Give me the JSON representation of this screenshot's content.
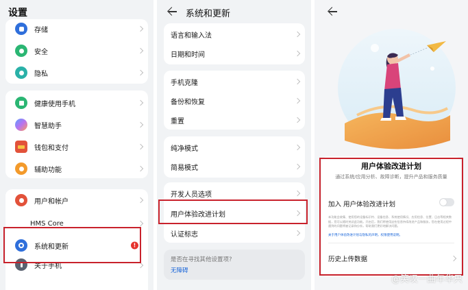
{
  "settings": {
    "title": "设置",
    "group1": [
      "存储",
      "安全",
      "隐私"
    ],
    "group2": [
      "健康使用手机",
      "智慧助手",
      "钱包和支付",
      "辅助功能"
    ],
    "group3": [
      "用户和帐户",
      "HMS Core",
      "系统和更新",
      "关于手机"
    ],
    "badge": "!"
  },
  "system": {
    "title": "系统和更新",
    "group1": [
      "语言和输入法",
      "日期和时间"
    ],
    "group2": [
      "手机克隆",
      "备份和恢复",
      "重置"
    ],
    "group3": [
      "纯净模式",
      "简易模式"
    ],
    "group4": [
      "开发人员选项",
      "用户体验改进计划",
      "认证标志"
    ],
    "hint_question": "是否在寻找其他设置项?",
    "hint_link": "无障碍"
  },
  "ux": {
    "title": "用户体验改进计划",
    "subtitle": "通过系统/应用分析、故障诊断，提升产品和服务质量",
    "toggle_label": "加入 用户体验改进计划",
    "body_text": "本功能会收集、使用您的设备标识符、设备信息、系统使用情况、应用信息、位置、日志等相关数据，您可以随时关闭此功能。开启后，我们将使用这些信息持续改进产品和服务，您在使用过程中遇到的问题将被记录和分析，帮助我们更好地解决问题。",
    "link_text": "关于用户体验改进计划与隐私的声明，权限使用说明。",
    "history": "历史上传数据",
    "watermark": "@笑叹一曲年华只"
  },
  "colors": {
    "red_highlight": "#c8212b",
    "link_blue": "#1a66d9",
    "icon_blue": "#2f6fdb",
    "icon_green": "#2bb673",
    "icon_teal": "#2ab1a8",
    "icon_orange": "#f39a2b",
    "icon_red": "#e2523a"
  }
}
